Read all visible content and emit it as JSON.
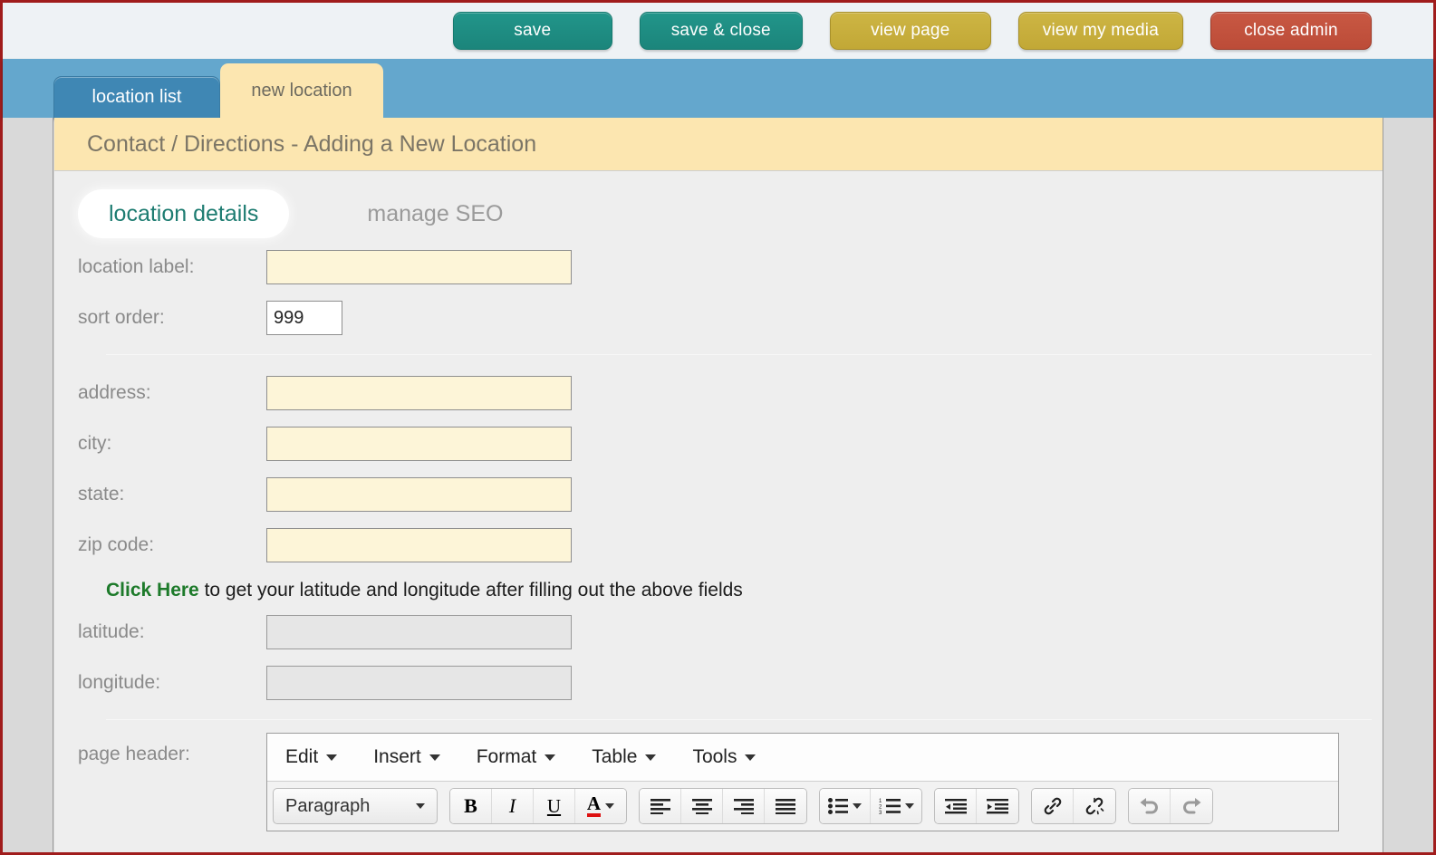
{
  "topbar": {
    "buttons": [
      {
        "label": "save",
        "style": "teal",
        "name": "save-button"
      },
      {
        "label": "save & close",
        "style": "teal",
        "name": "save-and-close-button"
      },
      {
        "label": "view page",
        "style": "gold",
        "name": "view-page-button"
      },
      {
        "label": "view my media",
        "style": "gold",
        "name": "view-my-media-button"
      },
      {
        "label": "close admin",
        "style": "brick",
        "name": "close-admin-button"
      }
    ],
    "colors": {
      "teal": "#1b857b",
      "gold": "#c2a836",
      "brick": "#bc4c38"
    }
  },
  "tabs": {
    "location_list": "location list",
    "new_location": "new location"
  },
  "breadcrumb": "Contact / Directions - Adding a New Location",
  "subtabs": {
    "active": "location details",
    "inactive": "manage SEO"
  },
  "form": {
    "location_label": {
      "label": "location label:",
      "value": "",
      "placeholder": ""
    },
    "sort_order": {
      "label": "sort order:",
      "value": "999"
    },
    "address": {
      "label": "address:",
      "value": ""
    },
    "city": {
      "label": "city:",
      "value": ""
    },
    "state": {
      "label": "state:",
      "value": ""
    },
    "zip_code": {
      "label": "zip code:",
      "value": ""
    },
    "geo_note_link": "Click Here",
    "geo_note_text": " to get your latitude and longitude after filling out the above fields",
    "latitude": {
      "label": "latitude:",
      "value": ""
    },
    "longitude": {
      "label": "longitude:",
      "value": ""
    },
    "page_header": {
      "label": "page header:"
    }
  },
  "editor": {
    "menu": [
      {
        "label": "Edit",
        "name": "menu-edit"
      },
      {
        "label": "Insert",
        "name": "menu-insert"
      },
      {
        "label": "Format",
        "name": "menu-format"
      },
      {
        "label": "Table",
        "name": "menu-table"
      },
      {
        "label": "Tools",
        "name": "menu-tools"
      }
    ],
    "style_select": "Paragraph",
    "buttons": {
      "bold": "B",
      "italic": "I",
      "underline": "U",
      "text_color": "A"
    }
  }
}
